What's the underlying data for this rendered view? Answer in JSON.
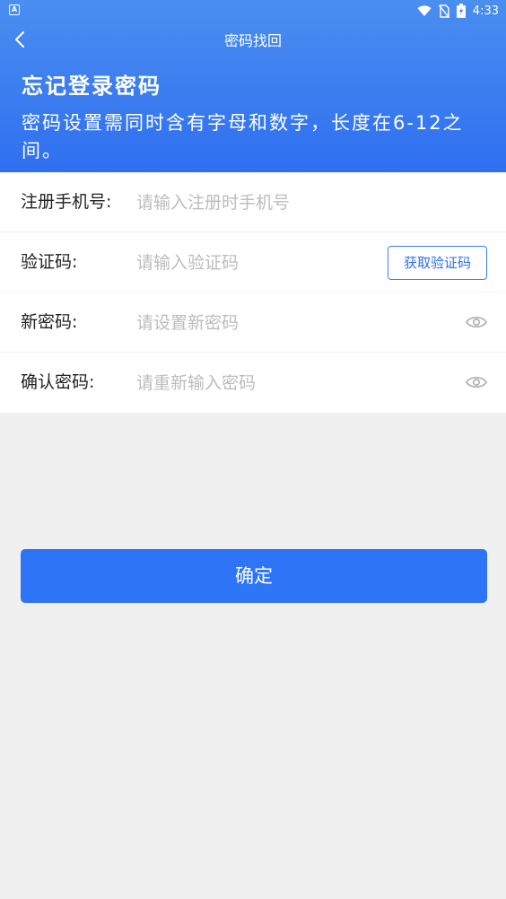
{
  "status_bar": {
    "left_icon": "A",
    "time": "4:33",
    "icons": [
      "wifi-icon",
      "no-sim-icon",
      "battery-charging-icon"
    ]
  },
  "nav": {
    "title": "密码找回",
    "back_icon": "chevron-left-icon"
  },
  "hero": {
    "title": "忘记登录密码",
    "description": "密码设置需同时含有字母和数字，长度在6-12之间。"
  },
  "form": {
    "phone": {
      "label": "注册手机号:",
      "placeholder": "请输入注册时手机号",
      "value": ""
    },
    "code": {
      "label": "验证码:",
      "placeholder": "请输入验证码",
      "value": "",
      "button_label": "获取验证码"
    },
    "new_password": {
      "label": "新密码:",
      "placeholder": "请设置新密码",
      "value": "",
      "toggle_icon": "eye-icon"
    },
    "confirm_password": {
      "label": "确认密码:",
      "placeholder": "请重新输入密码",
      "value": "",
      "toggle_icon": "eye-icon"
    }
  },
  "confirm_button": {
    "label": "确定"
  },
  "colors": {
    "primary": "#2d74f7",
    "header_gradient_top": "#4a8ef0",
    "header_gradient_bottom": "#2f6ff0",
    "placeholder": "#bcbcbc",
    "background": "#f0f0f0"
  }
}
